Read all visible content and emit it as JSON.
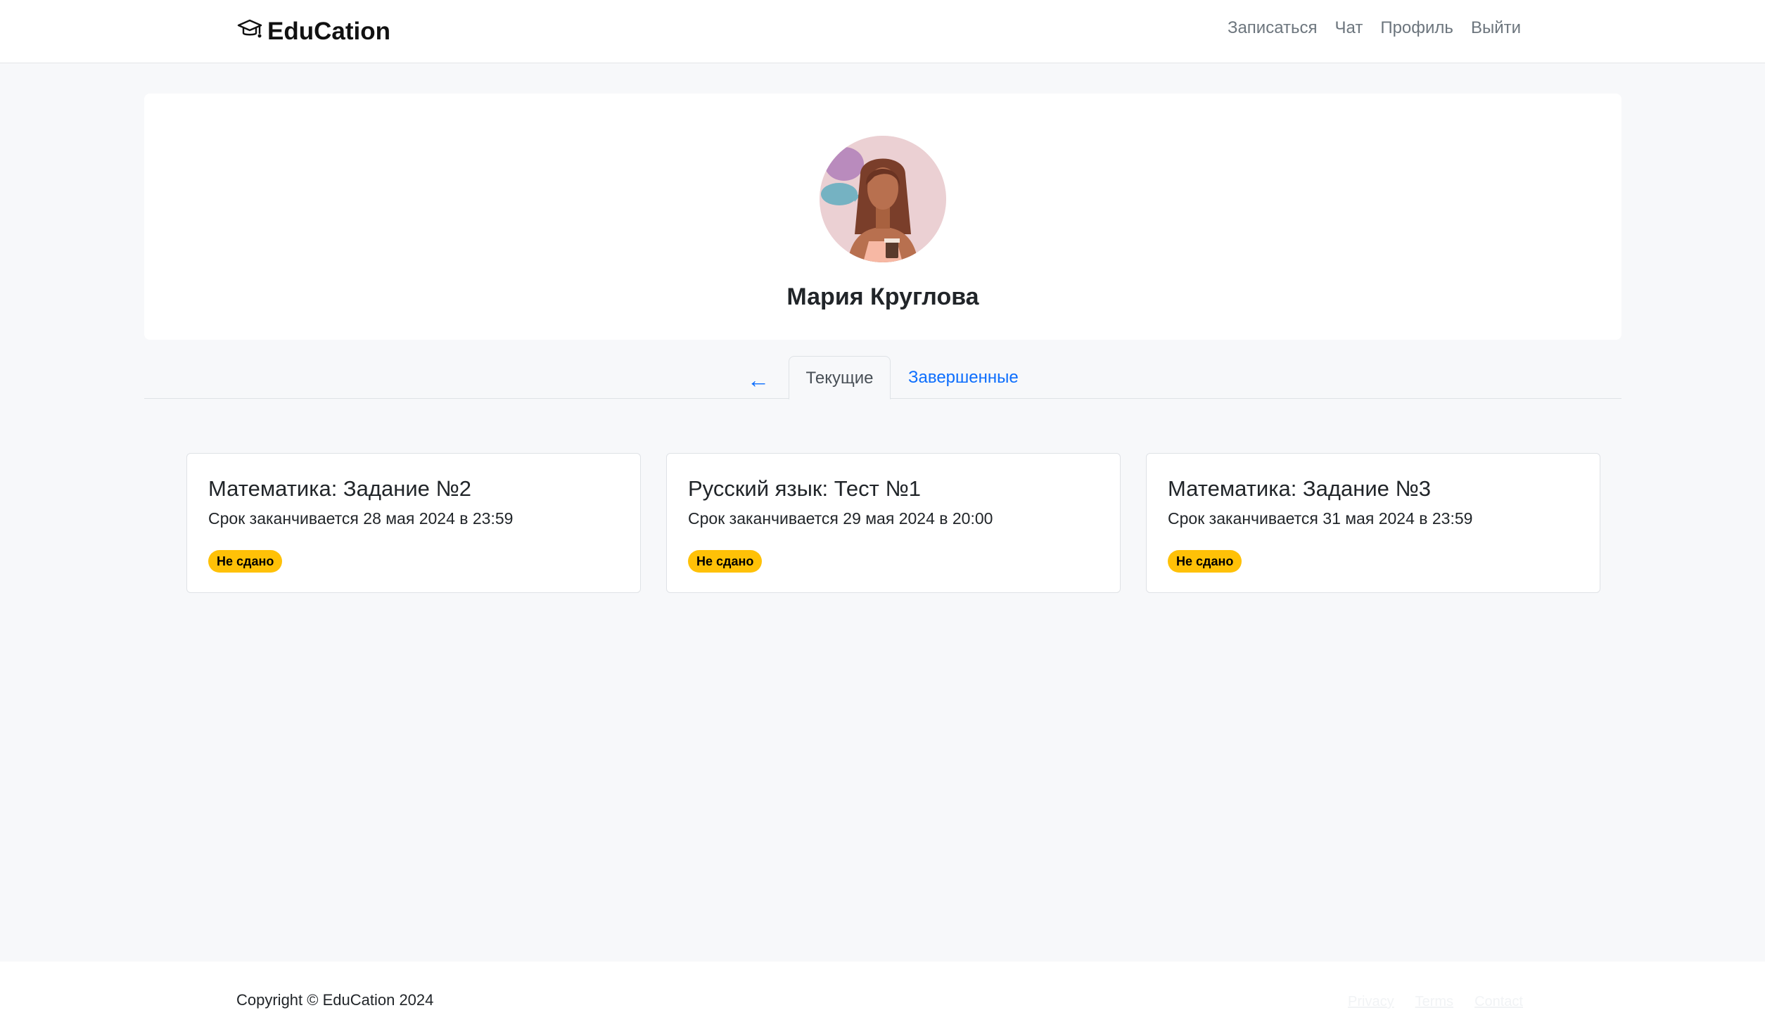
{
  "navbar": {
    "brand": "EduCation",
    "links": [
      "Записаться",
      "Чат",
      "Профиль",
      "Выйти"
    ]
  },
  "profile": {
    "name": "Мария Круглова"
  },
  "tabs": {
    "back": "←",
    "current": "Текущие",
    "completed": "Завершенные"
  },
  "tasks": [
    {
      "title": "Математика: Задание №2",
      "deadline": "Срок заканчивается 28 мая 2024 в 23:59",
      "status": "Не сдано"
    },
    {
      "title": "Русский язык: Тест №1",
      "deadline": "Срок заканчивается 29 мая 2024 в 20:00",
      "status": "Не сдано"
    },
    {
      "title": "Математика: Задание №3",
      "deadline": "Срок заканчивается 31 мая 2024 в 23:59",
      "status": "Не сдано"
    }
  ],
  "footer": {
    "copyright": "Copyright © EduCation 2024",
    "links": [
      "Privacy",
      "Terms",
      "Contact"
    ]
  },
  "colors": {
    "accent": "#0d6efd",
    "badge": "#ffc107",
    "background": "#f7f8fa"
  }
}
